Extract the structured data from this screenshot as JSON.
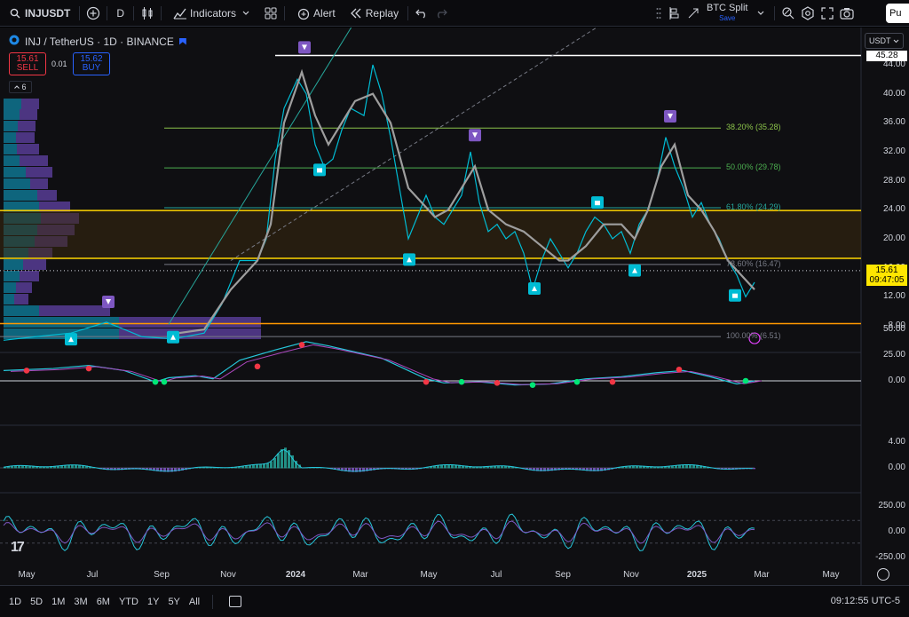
{
  "toolbar": {
    "symbol": "INJUSDT",
    "interval": "D",
    "indicators_label": "Indicators",
    "alert_label": "Alert",
    "replay_label": "Replay",
    "split_title": "BTC Split",
    "split_sub": "Save",
    "publish_label": "Pu"
  },
  "legend": {
    "title": "INJ / TetherUS · 1D · BINANCE",
    "sell_price": "15.61",
    "sell_label": "SELL",
    "spread": "0.01",
    "buy_price": "15.62",
    "buy_label": "BUY",
    "indicator_count": "6"
  },
  "currency": "USDT",
  "price_axis": {
    "labels": [
      "44.00",
      "40.00",
      "36.00",
      "32.00",
      "28.00",
      "24.00",
      "20.00",
      "16.00",
      "12.00",
      "8.00"
    ],
    "top_level": "45.28",
    "current_price": "15.61",
    "countdown": "09:47:05"
  },
  "fib_levels": [
    {
      "label": "38.20% (35.28)",
      "color": "#8bc34a"
    },
    {
      "label": "50.00% (29.78)",
      "color": "#4caf50"
    },
    {
      "label": "61.80% (24.29)",
      "color": "#26a69a"
    },
    {
      "label": "78.60% (16.47)",
      "color": "#787b86"
    },
    {
      "label": "100.00% (6.51)",
      "color": "#787b86"
    }
  ],
  "pane1_axis": [
    "50.00",
    "25.00",
    "0.00"
  ],
  "pane2_axis": [
    "4.00",
    "0.00"
  ],
  "pane3_axis": [
    "250.00",
    "0.00",
    "-250.00"
  ],
  "time_axis": [
    {
      "label": "May",
      "bold": false
    },
    {
      "label": "Jul",
      "bold": false
    },
    {
      "label": "Sep",
      "bold": false
    },
    {
      "label": "Nov",
      "bold": false
    },
    {
      "label": "2024",
      "bold": true
    },
    {
      "label": "Mar",
      "bold": false
    },
    {
      "label": "May",
      "bold": false
    },
    {
      "label": "Jul",
      "bold": false
    },
    {
      "label": "Sep",
      "bold": false
    },
    {
      "label": "Nov",
      "bold": false
    },
    {
      "label": "2025",
      "bold": true
    },
    {
      "label": "Mar",
      "bold": false
    },
    {
      "label": "May",
      "bold": false
    }
  ],
  "ranges": [
    "1D",
    "5D",
    "1M",
    "3M",
    "6M",
    "YTD",
    "1Y",
    "5Y",
    "All"
  ],
  "clock": "09:12:55 UTC-5",
  "colors": {
    "accent": "#2962ff",
    "yellow_level": "#ffd600",
    "orange_level": "#ff9800",
    "sell": "#f23645",
    "price_line": "#00bcd4",
    "ma_line": "#9e9e9e",
    "signal_marker": "#7e57c2",
    "cyan_marker": "#00bcd4"
  }
}
